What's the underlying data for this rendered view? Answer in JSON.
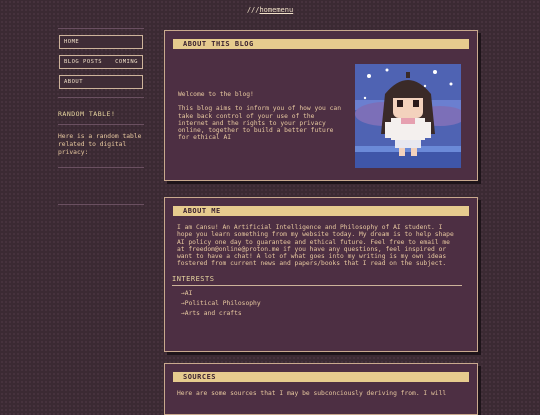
{
  "topnav": {
    "prefix": "///",
    "link": "homemenu"
  },
  "sidebar": {
    "buttons": [
      {
        "label": "HOME",
        "extra": ""
      },
      {
        "label": "BLOG POSTS",
        "extra": "COMING"
      },
      {
        "label": "ABOUT",
        "extra": ""
      }
    ],
    "random_title": "RANDOM TABLE!",
    "random_text": "Here is a random table related to digital privacy:"
  },
  "about_blog": {
    "title": "ABOUT THIS BLOG",
    "welcome": "Welcome to the blog!",
    "description": "This blog aims to inform you of how you can take back control of your use of the internet and the rights to your privacy online, together to build a better future for ethical AI"
  },
  "about_me": {
    "title": "ABOUT ME",
    "text": "I am Cansu! An Artificial Intelligence and Philosophy of AI student. I hope you learn something from my website today. My dream is to help shape AI policy one day to guarantee and ethical future. Feel free to email me at freedom@online@proton.me if you have any questions, feel inspired or want to have a chat! A lot of what goes into my writing is my own ideas fostered from current news and papers/books that I read on the subject.",
    "interests_title": "INTERESTS",
    "interests": [
      "AI",
      "Political Philosophy",
      "Arts and crafts"
    ]
  },
  "sources": {
    "title": "SOURCES",
    "text": "Here are some sources that I may be subconciously deriving from. I will"
  },
  "colors": {
    "accent": "#e6cb8e",
    "panel": "#4d2f43",
    "text": "#e8c9a0"
  }
}
